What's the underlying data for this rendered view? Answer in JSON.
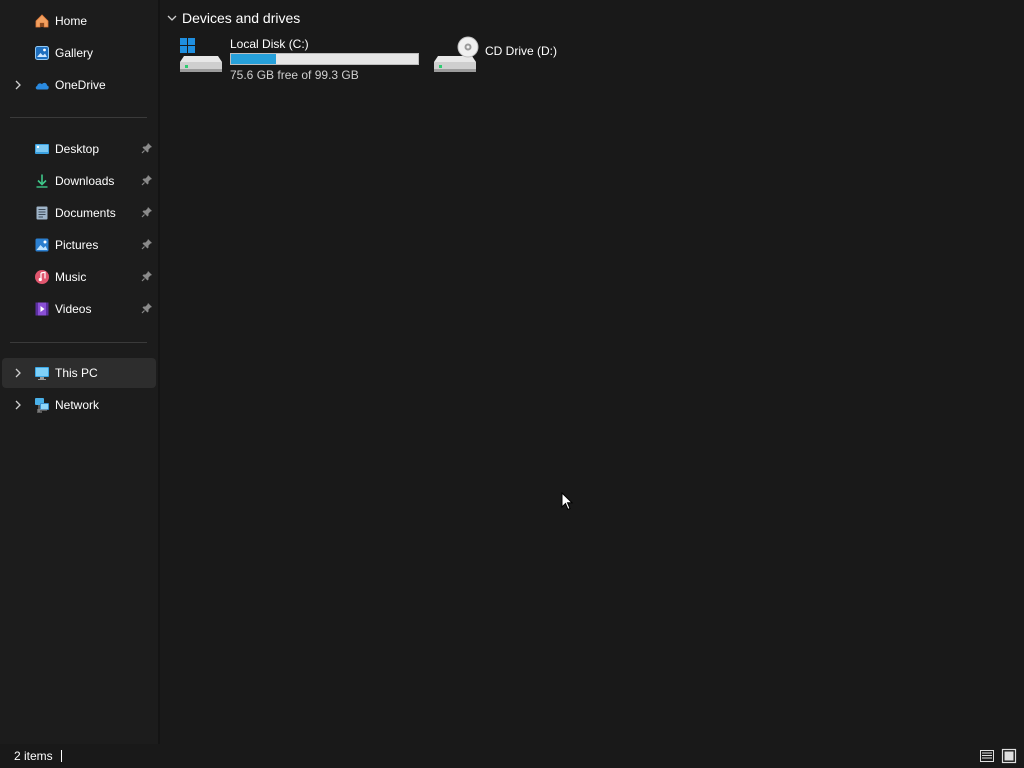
{
  "sidebar": {
    "items": [
      {
        "label": "Home",
        "icon": "home-icon"
      },
      {
        "label": "Gallery",
        "icon": "gallery-icon"
      },
      {
        "label": "OneDrive",
        "icon": "onedrive-icon"
      },
      {
        "label": "Desktop",
        "icon": "desktop-folder-icon",
        "pinned": true
      },
      {
        "label": "Downloads",
        "icon": "downloads-icon",
        "pinned": true
      },
      {
        "label": "Documents",
        "icon": "documents-icon",
        "pinned": true
      },
      {
        "label": "Pictures",
        "icon": "pictures-icon",
        "pinned": true
      },
      {
        "label": "Music",
        "icon": "music-icon",
        "pinned": true
      },
      {
        "label": "Videos",
        "icon": "videos-icon",
        "pinned": true
      },
      {
        "label": "This PC",
        "icon": "this-pc-icon",
        "selected": true
      },
      {
        "label": "Network",
        "icon": "network-icon"
      }
    ]
  },
  "main": {
    "group_title": "Devices and drives",
    "drives": [
      {
        "label": "Local Disk (C:)",
        "free_text": "75.6 GB free of 99.3 GB",
        "used_fraction": 0.239,
        "icon": "local-disk-icon"
      },
      {
        "label": "CD Drive (D:)",
        "icon": "cd-drive-icon"
      }
    ]
  },
  "statusbar": {
    "items_text": "2 items"
  },
  "colors": {
    "accent": "#26a0da",
    "background": "#191919",
    "sidebar": "#1c1c1c",
    "selected": "#2d2d2d"
  }
}
